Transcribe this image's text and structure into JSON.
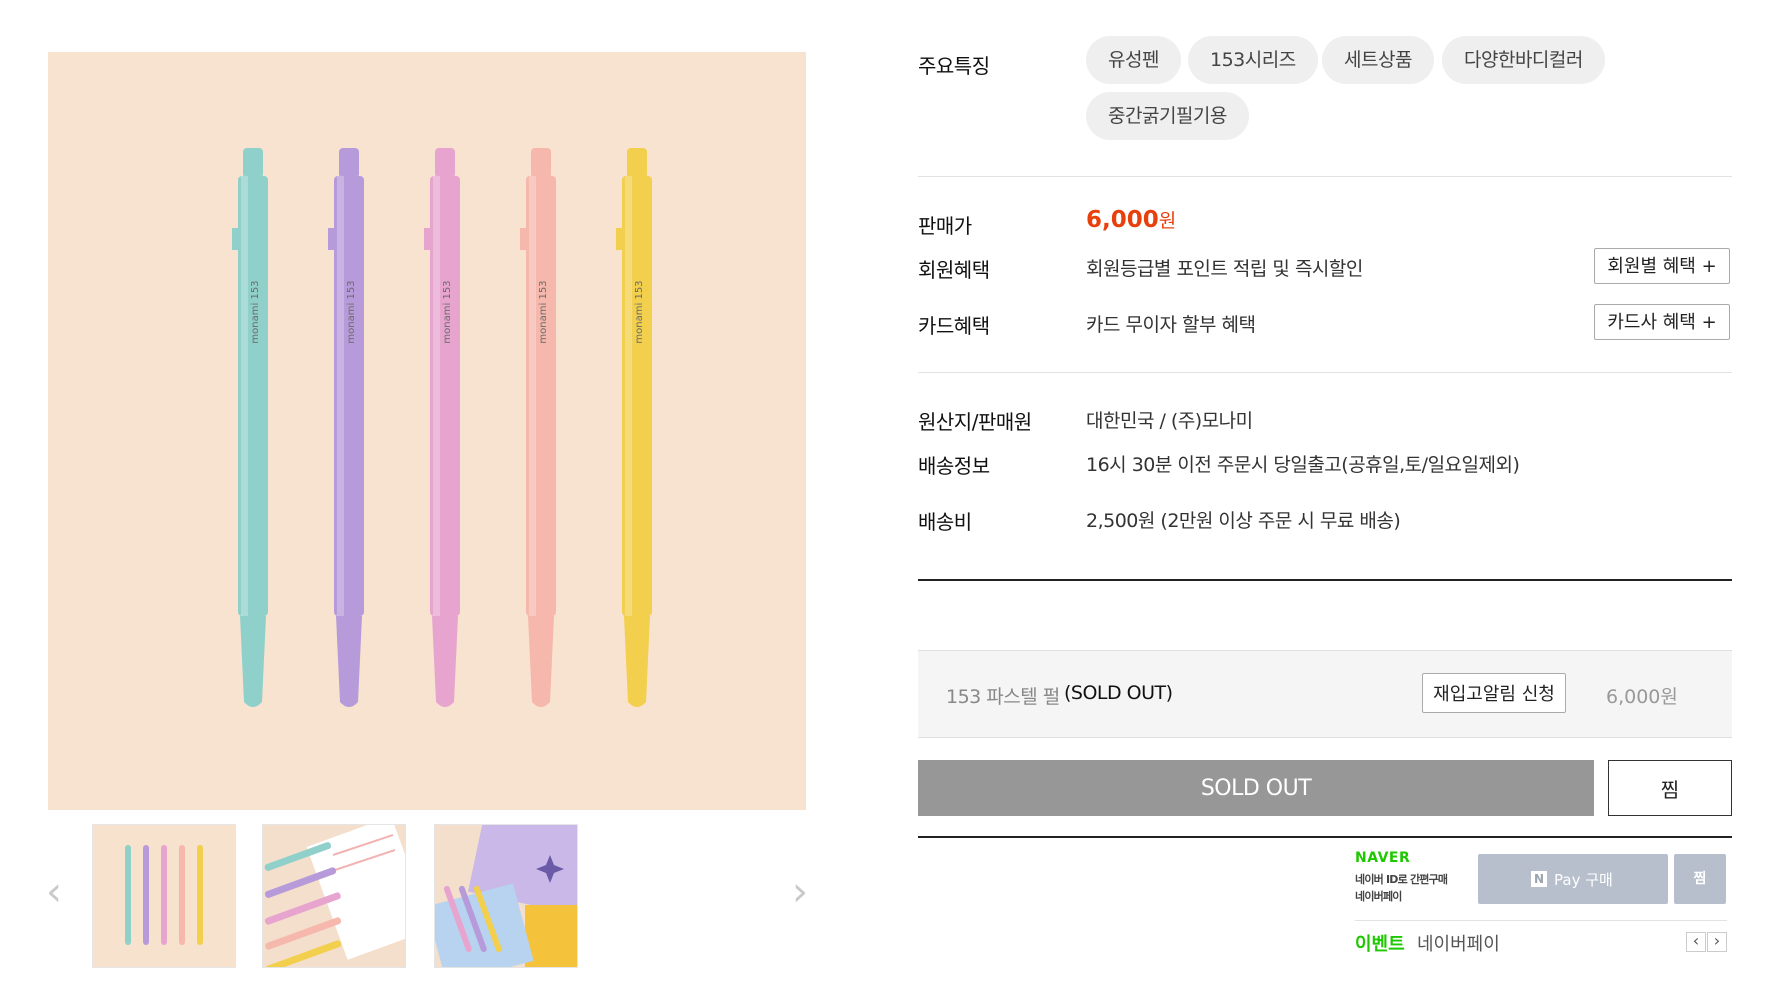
{
  "features": {
    "label": "주요특징",
    "tags": [
      "유성펜",
      "153시리즈",
      "세트상품",
      "다양한바디컬러",
      "중간굵기필기용"
    ]
  },
  "price": {
    "label": "판매가",
    "amount": "6,000",
    "unit": "원"
  },
  "member_benefit": {
    "label": "회원혜택",
    "text": "회원등급별 포인트 적립 및 즉시할인",
    "button": "회원별 혜택 +"
  },
  "card_benefit": {
    "label": "카드혜택",
    "text": "카드 무이자 할부 혜택",
    "button": "카드사 혜택 +"
  },
  "origin": {
    "label": "원산지/판매원",
    "text": "대한민국 / (주)모나미"
  },
  "shipping_info": {
    "label": "배송정보",
    "text": "16시 30분 이전 주문시 당일출고(공휴일,토/일요일제외)"
  },
  "shipping_fee": {
    "label": "배송비",
    "text": "2,500원 (2만원 이상 주문 시 무료 배송)"
  },
  "option": {
    "name": "153 파스텔 펄",
    "status": "(SOLD OUT)",
    "restock_button": "재입고알림 신청",
    "price": "6,000원"
  },
  "actions": {
    "soldout": "SOLD OUT",
    "wish": "찜"
  },
  "naver": {
    "brand": "NAVER",
    "line1": "네이버 ID로 간편구매",
    "line2": "네이버페이",
    "pay_label": "Pay 구매",
    "n_logo": "N",
    "wish": "찜",
    "event_label": "이벤트",
    "event_text": "네이버페이",
    "prev": "‹",
    "next": "›"
  },
  "gallery": {
    "prev": "‹",
    "next": "›",
    "pen_colors": [
      "#8fd0cb",
      "#b79ad9",
      "#e7a4cf",
      "#f6b7ad",
      "#f2cf4c"
    ],
    "pen_brand": "monami  153"
  }
}
